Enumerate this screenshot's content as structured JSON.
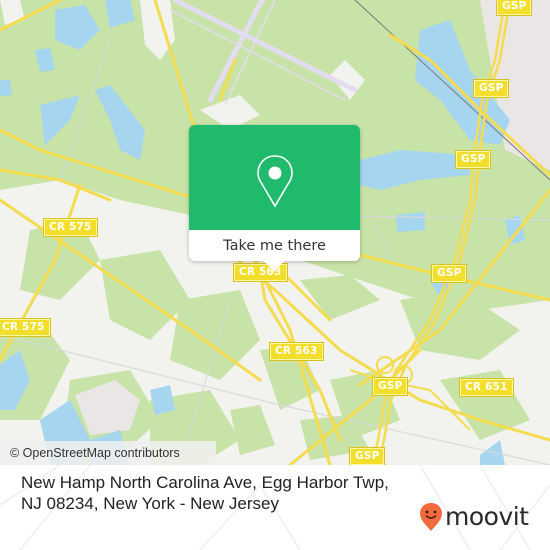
{
  "map": {
    "colors": {
      "forest": "#c8e3a7",
      "urban": "#f2f2ee",
      "water": "#a6d5ef",
      "road": "#f5dc4e",
      "runway": "#e4dcf0",
      "industrial": "#ebe6e6"
    },
    "road_labels": [
      {
        "id": "cr575-a",
        "text": "CR 575"
      },
      {
        "id": "cr575-b",
        "text": "CR 575"
      },
      {
        "id": "cr563-a",
        "text": "CR 563"
      },
      {
        "id": "cr563-b",
        "text": "CR 563"
      },
      {
        "id": "cr651",
        "text": "CR 651"
      },
      {
        "id": "gsp-1",
        "text": "GSP"
      },
      {
        "id": "gsp-2",
        "text": "GSP"
      },
      {
        "id": "gsp-3",
        "text": "GSP"
      },
      {
        "id": "gsp-4",
        "text": "GSP"
      },
      {
        "id": "gsp-5",
        "text": "GSP"
      },
      {
        "id": "gsp-6",
        "text": "GSP"
      }
    ],
    "attribution": "© OpenStreetMap contributors"
  },
  "popup": {
    "icon": "map-pin-icon",
    "button_label": "Take me there",
    "accent_color": "#1fba6b"
  },
  "footer": {
    "address": "New Hamp North Carolina Ave, Egg Harbor Twp, NJ 08234, New York - New Jersey",
    "brand": "moovit",
    "brand_color": "#f26a3d"
  }
}
